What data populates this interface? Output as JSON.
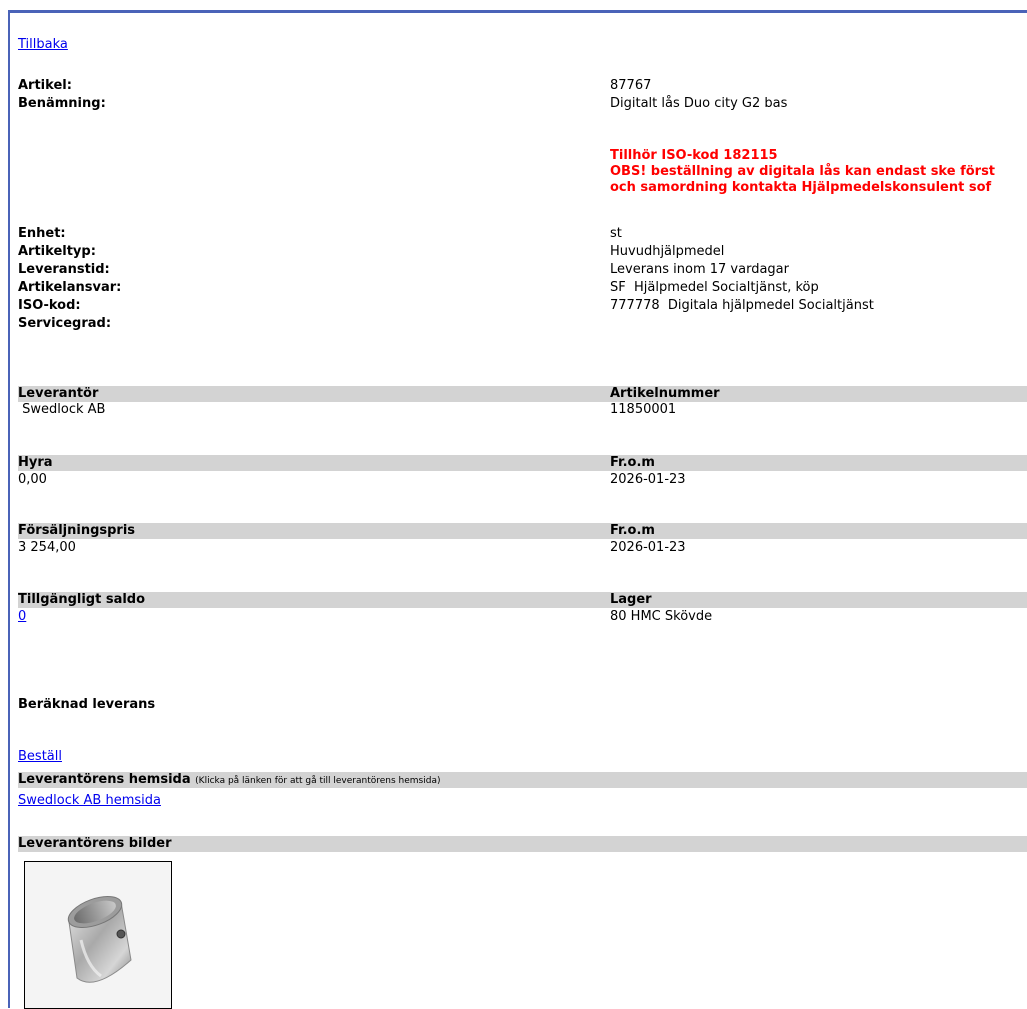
{
  "back_link": "Tillbaka",
  "fields": [
    {
      "label": "Artikel:",
      "value": "87767"
    },
    {
      "label": "Benämning:",
      "value": "Digitalt lås Duo city G2 bas"
    }
  ],
  "notice": [
    "Tillhör ISO-kod 182115",
    "OBS! beställning av digitala lås kan endast ske först",
    "och samordning kontakta Hjälpmedelskonsulent sof"
  ],
  "fields2": [
    {
      "label": "Enhet:",
      "value": "st"
    },
    {
      "label": "Artikeltyp:",
      "value": "Huvudhjälpmedel"
    },
    {
      "label": "Leveranstid:",
      "value": "Leverans inom 17 vardagar"
    },
    {
      "label": "Artikelansvar:",
      "value": "SF  Hjälpmedel Socialtjänst, köp"
    },
    {
      "label": "ISO-kod:",
      "value": "777778  Digitala hjälpmedel Socialtjänst"
    },
    {
      "label": "Servicegrad:",
      "value": ""
    }
  ],
  "sections": {
    "supplier": {
      "h1": "Leverantör",
      "h2": "Artikelnummer",
      "v1": " Swedlock AB",
      "v2": "11850001"
    },
    "rent": {
      "h1": "Hyra",
      "h2": "Fr.o.m",
      "v1": "0,00",
      "v2": "2026-01-23"
    },
    "sales": {
      "h1": "Försäljningspris",
      "h2": "Fr.o.m",
      "v1": "3 254,00",
      "v2": "2026-01-23"
    },
    "stock": {
      "h1": "Tillgängligt saldo",
      "h2": "Lager",
      "v1": "0",
      "v2": "80 HMC Skövde"
    }
  },
  "estimated_delivery": "Beräknad leverans",
  "order_link": "Beställ",
  "homepage": {
    "header": "Leverantörens hemsida",
    "hint": "(Klicka på länken för att gå till leverantörens hemsida)",
    "link": "Swedlock AB hemsida"
  },
  "images_header": "Leverantörens bilder",
  "product_image_icon": "door-lock-cylinder"
}
